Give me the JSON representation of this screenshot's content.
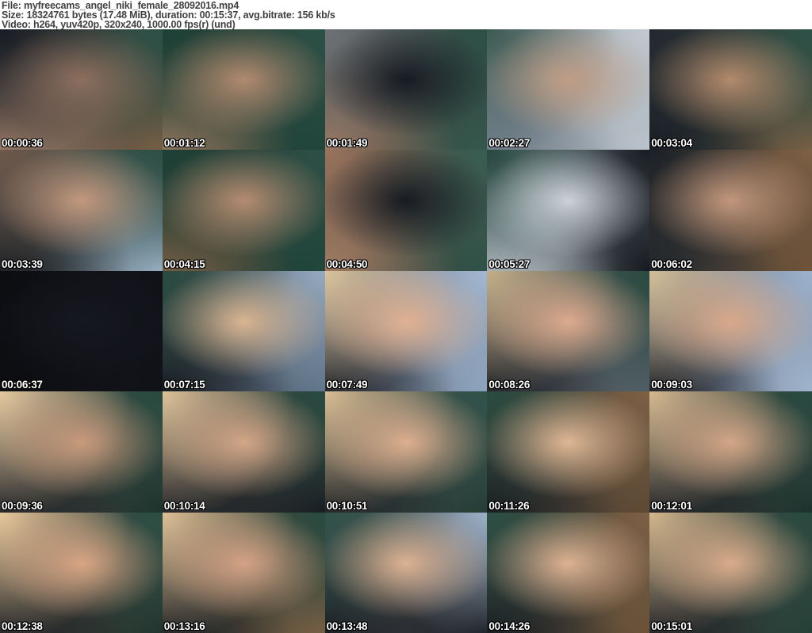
{
  "header": {
    "lines": [
      "File: myfreecams_angel_niki_female_28092016.mp4",
      "Size: 18324761 bytes (17.48 MiB), duration: 00:15:37, avg.bitrate: 156 kb/s",
      "Video: h264, yuv420p, 320x240, 1000.00 fps(r) (und)"
    ],
    "text_color": "#414141",
    "background_color": "#ffffff"
  },
  "grid": {
    "columns": 5,
    "rows": 5,
    "timestamp_color": "#ffffff",
    "timestamp_outline_color": "#000000",
    "thumbnails": [
      {
        "time": "00:00:36",
        "colors": {
          "tl": "#191d24",
          "tr": "#2d5046",
          "center": "#8d6f5e",
          "bl": "#a5806a",
          "br": "#7e6044",
          "base": "#3c423f"
        }
      },
      {
        "time": "00:01:12",
        "colors": {
          "tl": "#1d4036",
          "tr": "#2d5046",
          "center": "#b18a6f",
          "bl": "#9c7a5e",
          "br": "#1f453a",
          "base": "#284038"
        }
      },
      {
        "time": "00:01:49",
        "colors": {
          "tl": "#6d7276",
          "tr": "#2d5046",
          "center": "#171b22",
          "bl": "#a07a62",
          "br": "#35584c",
          "base": "#3f4644"
        }
      },
      {
        "time": "00:02:27",
        "colors": {
          "tl": "#3d5a52",
          "tr": "#c3cad1",
          "center": "#c09d85",
          "bl": "#717e8c",
          "br": "#b9c3cb",
          "base": "#8e979e"
        }
      },
      {
        "time": "00:03:04",
        "colors": {
          "tl": "#23282e",
          "tr": "#2d5046",
          "center": "#b28a6c",
          "bl": "#171b22",
          "br": "#7e6044",
          "base": "#34413c"
        }
      },
      {
        "time": "00:03:39",
        "colors": {
          "tl": "#6e584a",
          "tr": "#2d5046",
          "center": "#c2987e",
          "bl": "#171b22",
          "br": "#9fb6cc",
          "base": "#45504e"
        }
      },
      {
        "time": "00:04:15",
        "colors": {
          "tl": "#1d4036",
          "tr": "#2d5046",
          "center": "#b58c71",
          "bl": "#7e6044",
          "br": "#1f453a",
          "base": "#263d35"
        }
      },
      {
        "time": "00:04:50",
        "colors": {
          "tl": "#9a735c",
          "tr": "#3a5e52",
          "center": "#171b22",
          "bl": "#a57e64",
          "br": "#2d5046",
          "base": "#474a42"
        }
      },
      {
        "time": "00:05:27",
        "colors": {
          "tl": "#26473e",
          "tr": "#171b22",
          "center": "#ccd2d7",
          "bl": "#b4bbc2",
          "br": "#15181e",
          "base": "#808a91"
        }
      },
      {
        "time": "00:06:02",
        "colors": {
          "tl": "#1c2127",
          "tr": "#7e6044",
          "center": "#c2977c",
          "bl": "#23282e",
          "br": "#6e5138",
          "base": "#4a4337"
        }
      },
      {
        "time": "00:06:37",
        "colors": {
          "tl": "#0c0d11",
          "tr": "#101218",
          "center": "#16181f",
          "bl": "#0c0d11",
          "br": "#101218",
          "base": "#121419"
        }
      },
      {
        "time": "00:07:15",
        "colors": {
          "tl": "#2a4a40",
          "tr": "#96abc2",
          "center": "#d9b591",
          "bl": "#14171e",
          "br": "#5d7288",
          "base": "#4c5660"
        }
      },
      {
        "time": "00:07:49",
        "colors": {
          "tl": "#dbc29a",
          "tr": "#a3b8d2",
          "center": "#e0b192",
          "bl": "#14171e",
          "br": "#8ba2bc",
          "base": "#6c7584"
        }
      },
      {
        "time": "00:08:26",
        "colors": {
          "tl": "#c4ae88",
          "tr": "#2a4a40",
          "center": "#dcaa8d",
          "bl": "#14171e",
          "br": "#525e68",
          "base": "#575c5e"
        }
      },
      {
        "time": "00:09:03",
        "colors": {
          "tl": "#d2bd96",
          "tr": "#9cb2cc",
          "center": "#d8a88b",
          "bl": "#14171e",
          "br": "#a0b5ce",
          "base": "#6e7787"
        }
      },
      {
        "time": "00:09:36",
        "colors": {
          "tl": "#e4c89e",
          "tr": "#284a40",
          "center": "#c89a7c",
          "bl": "#16191f",
          "br": "#1d302b",
          "base": "#484c46"
        }
      },
      {
        "time": "00:10:14",
        "colors": {
          "tl": "#dec29a",
          "tr": "#284a40",
          "center": "#d3a687",
          "bl": "#16191f",
          "br": "#16191f",
          "base": "#3f443f"
        }
      },
      {
        "time": "00:10:51",
        "colors": {
          "tl": "#d8bc93",
          "tr": "#31524a",
          "center": "#dcae8e",
          "bl": "#16191f",
          "br": "#233b34",
          "base": "#444f4a"
        }
      },
      {
        "time": "00:11:26",
        "colors": {
          "tl": "#2a4a40",
          "tr": "#7e6044",
          "center": "#dfb694",
          "bl": "#16191f",
          "br": "#5c4632",
          "base": "#49483c"
        }
      },
      {
        "time": "00:12:01",
        "colors": {
          "tl": "#d5b990",
          "tr": "#284a40",
          "center": "#d3a687",
          "bl": "#16191f",
          "br": "#1d302b",
          "base": "#3e433f"
        }
      },
      {
        "time": "00:12:38",
        "colors": {
          "tl": "#e7c79b",
          "tr": "#2c4e44",
          "center": "#d8a584",
          "bl": "#16191f",
          "br": "#20332d",
          "base": "#47473f"
        }
      },
      {
        "time": "00:13:16",
        "colors": {
          "tl": "#ddbf96",
          "tr": "#2a4a40",
          "center": "#d4a285",
          "bl": "#16191f",
          "br": "#7e6044",
          "base": "#424639"
        }
      },
      {
        "time": "00:13:48",
        "colors": {
          "tl": "#31524a",
          "tr": "#9bafc5",
          "center": "#ddb292",
          "bl": "#16191f",
          "br": "#16191f",
          "base": "#4e5354"
        }
      },
      {
        "time": "00:14:26",
        "colors": {
          "tl": "#2c4e44",
          "tr": "#7e6044",
          "center": "#ddb292",
          "bl": "#16191f",
          "br": "#6b5138",
          "base": "#46453a"
        }
      },
      {
        "time": "00:15:01",
        "colors": {
          "tl": "#d2b68d",
          "tr": "#2a4a40",
          "center": "#d9ac8b",
          "bl": "#16191f",
          "br": "#243f37",
          "base": "#414640"
        }
      }
    ]
  }
}
